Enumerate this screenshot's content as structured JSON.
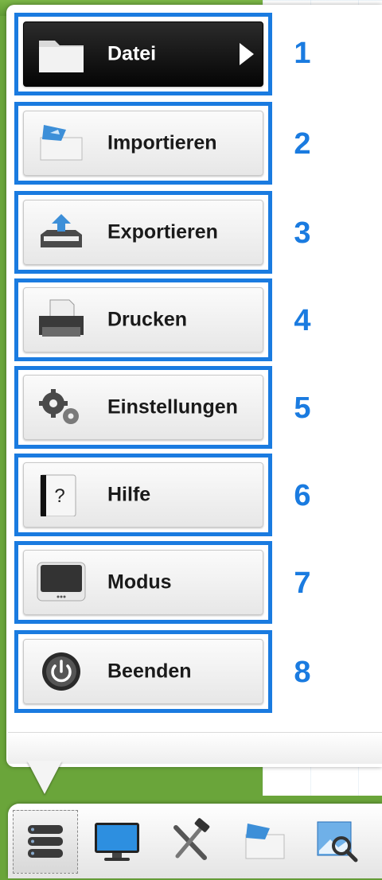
{
  "menu": {
    "items": [
      {
        "label": "Datei",
        "number": "1",
        "icon": "folder-icon",
        "active": true
      },
      {
        "label": "Importieren",
        "number": "2",
        "icon": "import-icon",
        "active": false
      },
      {
        "label": "Exportieren",
        "number": "3",
        "icon": "export-icon",
        "active": false
      },
      {
        "label": "Drucken",
        "number": "4",
        "icon": "printer-icon",
        "active": false
      },
      {
        "label": "Einstellungen",
        "number": "5",
        "icon": "gears-icon",
        "active": false
      },
      {
        "label": "Hilfe",
        "number": "6",
        "icon": "help-icon",
        "active": false
      },
      {
        "label": "Modus",
        "number": "7",
        "icon": "tablet-icon",
        "active": false
      },
      {
        "label": "Beenden",
        "number": "8",
        "icon": "power-icon",
        "active": false
      }
    ]
  },
  "colors": {
    "highlight": "#1a7be0",
    "active_bg": "#000000",
    "app_green": "#6aa53a"
  },
  "toolbar": {
    "buttons": [
      {
        "icon": "menu-icon",
        "selected": true
      },
      {
        "icon": "monitor-icon",
        "selected": false
      },
      {
        "icon": "tools-icon",
        "selected": false
      },
      {
        "icon": "import-icon",
        "selected": false
      },
      {
        "icon": "image-search-icon",
        "selected": false
      }
    ]
  }
}
